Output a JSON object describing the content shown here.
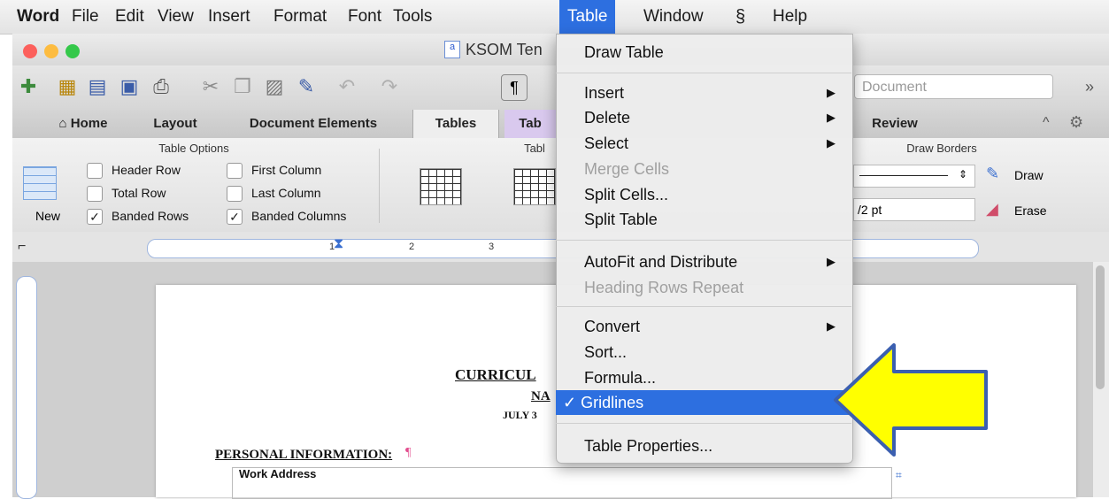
{
  "menubar": {
    "app": "Word",
    "items": [
      "File",
      "Edit",
      "View",
      "Insert",
      "Format",
      "Font",
      "Tools",
      "Table",
      "Window",
      "Help"
    ]
  },
  "window": {
    "title": "KSOM Ten",
    "search_placeholder": "Document"
  },
  "ribbon": {
    "tabs": [
      "Home",
      "Layout",
      "Document Elements",
      "Tables",
      "Tab",
      "Review"
    ],
    "table_options": {
      "title": "Table Options",
      "new_label": "New",
      "header_row": "Header Row",
      "total_row": "Total Row",
      "banded_rows": "Banded Rows",
      "first_column": "First Column",
      "last_column": "Last Column",
      "banded_columns": "Banded Columns"
    },
    "table_styles_title": "Tabl",
    "draw_borders": {
      "title": "Draw Borders",
      "weight": "/2 pt",
      "draw_label": "Draw",
      "erase_label": "Erase"
    }
  },
  "ruler": {
    "marks": [
      "1",
      "2",
      "3"
    ]
  },
  "document": {
    "heading": "CURRICUL",
    "name_line": "NA",
    "date_line": "JULY 3",
    "section": "PERSONAL INFORMATION:",
    "pilcrow": "¶",
    "row_label": "Work Address"
  },
  "table_menu": {
    "items": {
      "draw_table": "Draw Table",
      "insert": "Insert",
      "delete": "Delete",
      "select": "Select",
      "merge_cells": "Merge Cells",
      "split_cells": "Split Cells...",
      "split_table": "Split Table",
      "autofit": "AutoFit and Distribute",
      "heading_rows": "Heading Rows Repeat",
      "convert": "Convert",
      "sort": "Sort...",
      "formula": "Formula...",
      "gridlines": "Gridlines",
      "table_properties": "Table Properties..."
    },
    "check_mark": "✓",
    "submenu_arrow": "▶"
  },
  "colors": {
    "selection": "#2d6fe0",
    "arrow_fill": "#ffff00",
    "arrow_stroke": "#3b5fb0"
  }
}
